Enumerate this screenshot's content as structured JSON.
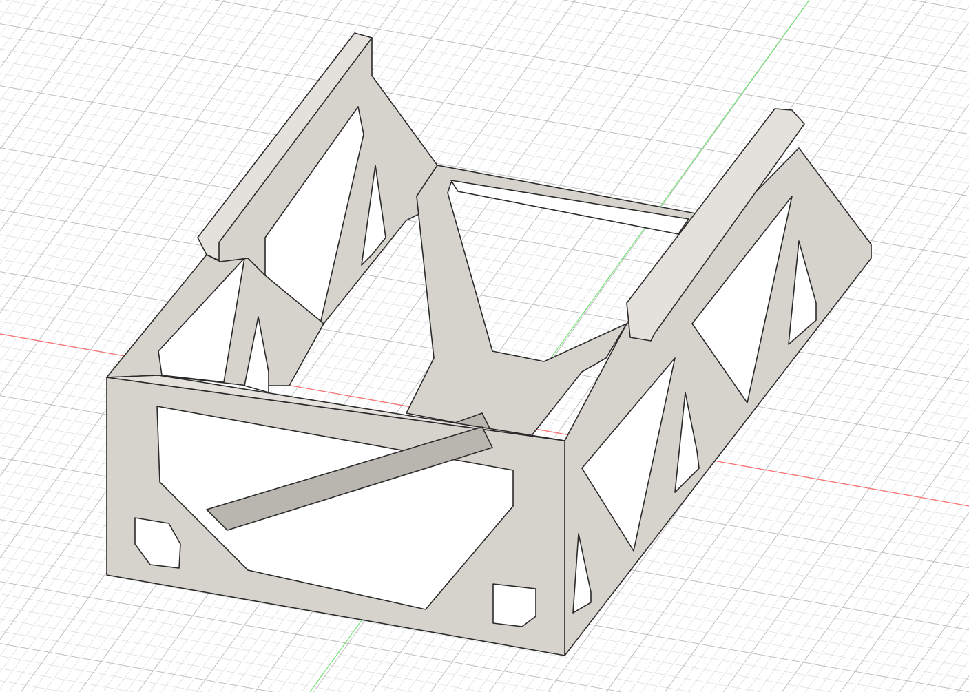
{
  "viewport": {
    "background": "#ffffff",
    "grid_minor_color": "#dcdcdc",
    "grid_major_color": "#bdbdbd",
    "x_axis_color": "#ff7070",
    "y_axis_color": "#70e070",
    "model_color": "#d6d3cd",
    "model_shadow_color": "#b9b6b0",
    "model_dark_color": "#8f8c87"
  }
}
